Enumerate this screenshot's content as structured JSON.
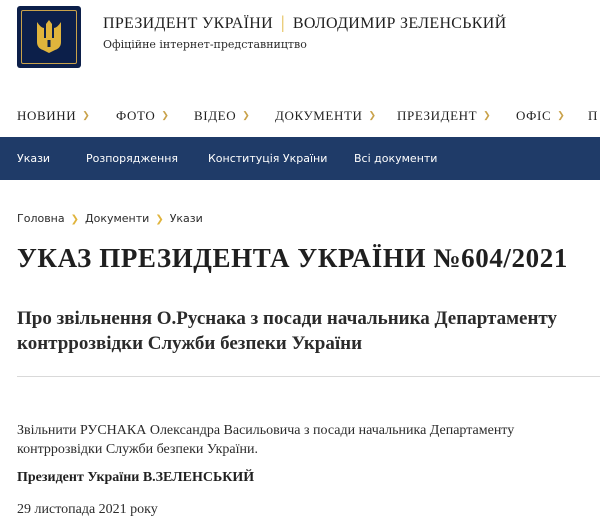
{
  "header": {
    "title_left": "ПРЕЗИДЕНТ УКРАЇНИ",
    "separator": "|",
    "title_right": "ВОЛОДИМИР ЗЕЛЕНСЬКИЙ",
    "subtitle": "Офіційне інтернет-представництво",
    "logo_icon": "trident-coat-of-arms-icon"
  },
  "main_nav": {
    "items": [
      "НОВИНИ",
      "ФОТО",
      "ВІДЕО",
      "ДОКУМЕНТИ",
      "ПРЕЗИДЕНТ",
      "ОФІС",
      "П"
    ],
    "chevron_icon": "chevron-down-icon"
  },
  "sub_nav": {
    "items": [
      "Укази",
      "Розпорядження",
      "Конституція України",
      "Всі документи"
    ]
  },
  "breadcrumb": {
    "items": [
      "Головна",
      "Документи",
      "Укази"
    ],
    "separator_icon": "chevron-right-icon"
  },
  "document": {
    "title": "УКАЗ ПРЕЗИДЕНТА УКРАЇНИ №604/2021",
    "subtitle": "Про звільнення О.Руснака з посади начальника Департаменту контррозвідки Служби безпеки України",
    "body": "Звільнити РУСНАКА Олександра Васильовича з посади начальника Департаменту контррозвідки Служби безпеки України.",
    "signature": "Президент України В.ЗЕЛЕНСЬКИЙ",
    "date": "29 листопада 2021 року"
  },
  "colors": {
    "navy": "#1f3b68",
    "logo_bg": "#0c1f4a",
    "gold": "#e0b43c"
  }
}
